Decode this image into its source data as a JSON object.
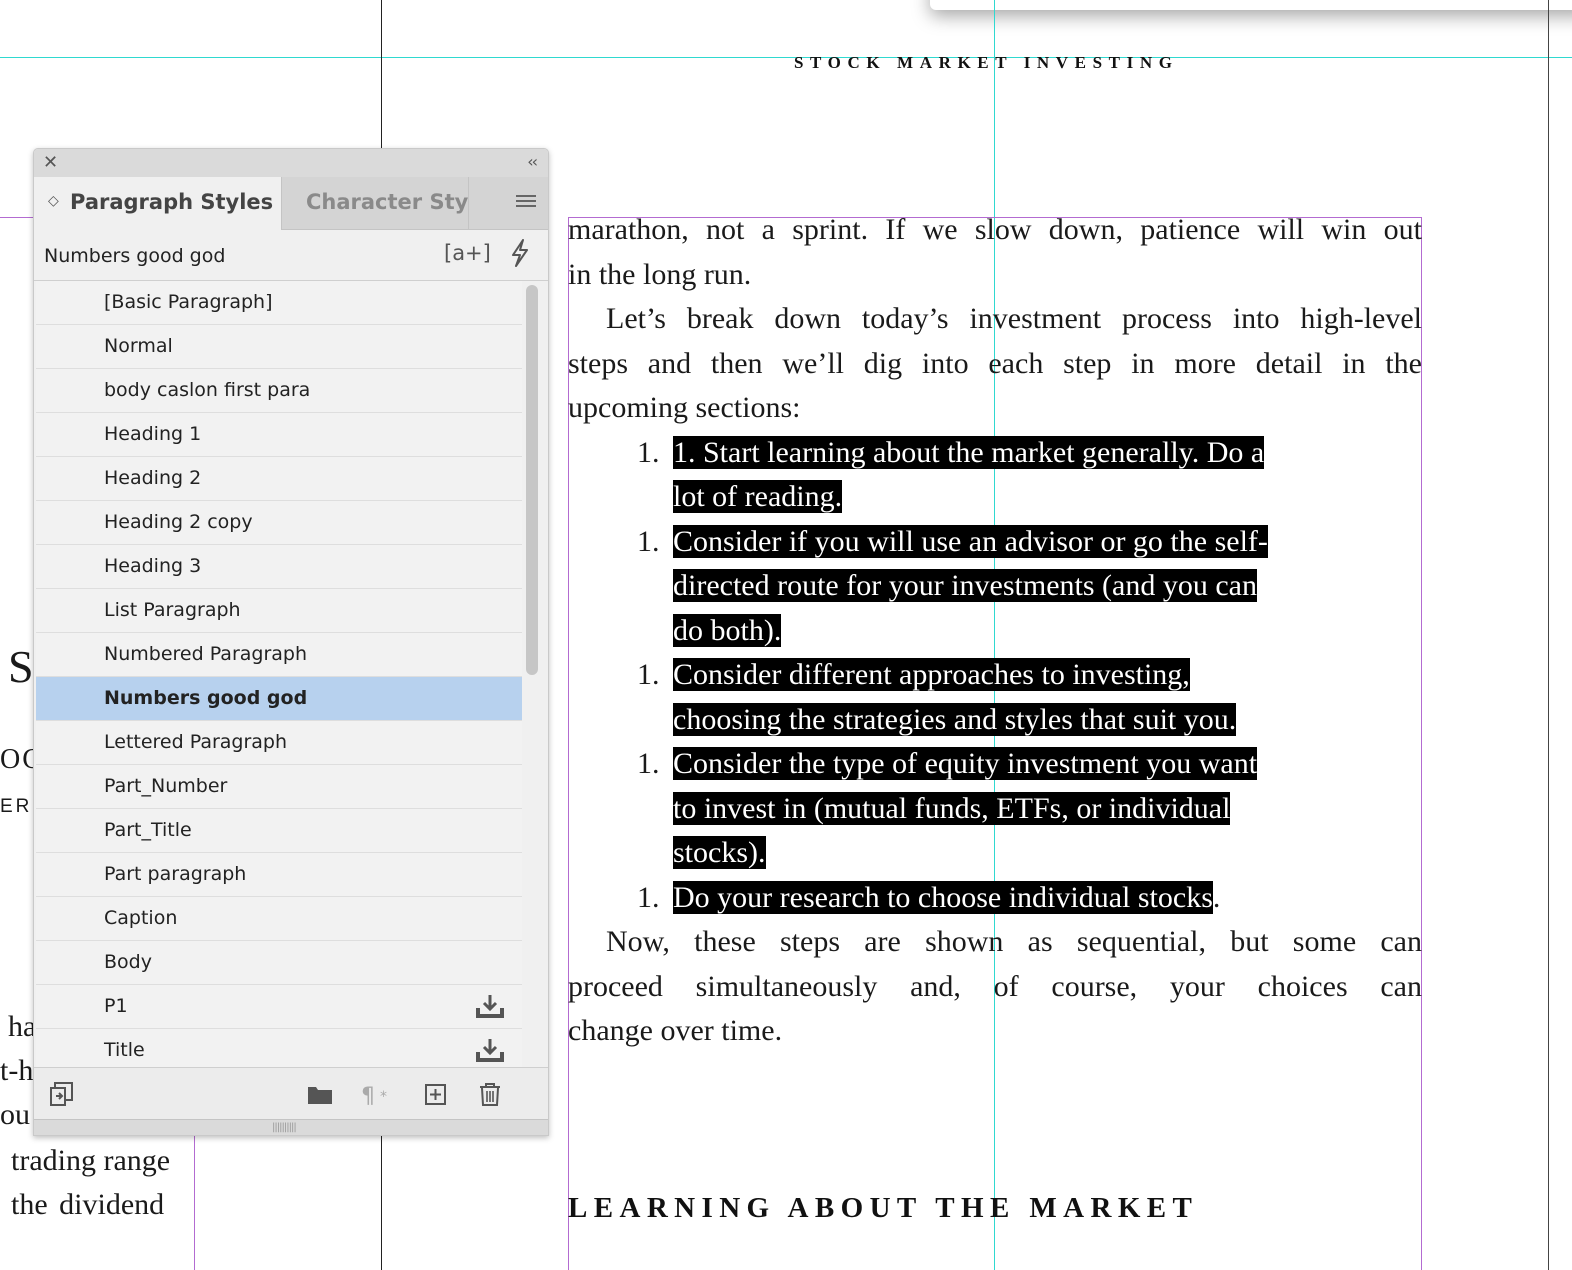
{
  "document": {
    "running_head": "STOCK MARKET INVESTING",
    "intro_lines": [
      "marathon, not a sprint. If we slow down, patience will win out",
      "in the long run."
    ],
    "para2_lines": [
      "Let’s break down today’s investment process into high-level",
      "steps and then we’ll dig into each step in more detail in the",
      "upcoming sections:"
    ],
    "list_number": "1.",
    "list_items": [
      {
        "lines": [
          "1.  Start learning about the market generally. Do a",
          "lot of reading. "
        ]
      },
      {
        "lines": [
          "Consider if you will use an advisor or go the self-",
          "directed route for your investments (and you can",
          "do both). "
        ]
      },
      {
        "lines": [
          "Consider different approaches to investing,",
          "choosing the strategies and styles that suit you. "
        ]
      },
      {
        "lines": [
          "Consider the type of equity investment you want",
          "to invest in (mutual funds, ETFs, or individual",
          "stocks). "
        ]
      },
      {
        "lines": [
          "Do your research to choose individual stocks"
        ]
      }
    ],
    "last_item_period": ".",
    "closing_lines": [
      "Now, these steps are shown as sequential, but some can",
      "proceed simultaneously and, of course, your choices can",
      "change over time."
    ],
    "section_heading": "LEARNING ABOUT THE MARKET",
    "left_page_fragments": [
      "S",
      "OC",
      "ER",
      "ha",
      "t-h",
      "ou",
      "trading range",
      "the  dividend"
    ]
  },
  "panel": {
    "tabs": [
      {
        "label": "Paragraph Styles",
        "active": true
      },
      {
        "label": "Character Styles",
        "active": false
      }
    ],
    "current_style": "Numbers good god",
    "override_icon_label": "[a+]",
    "styles": [
      {
        "name": "[Basic Paragraph]"
      },
      {
        "name": "Normal"
      },
      {
        "name": "body caslon first para"
      },
      {
        "name": "Heading 1"
      },
      {
        "name": "Heading 2"
      },
      {
        "name": "Heading 2 copy"
      },
      {
        "name": "Heading 3"
      },
      {
        "name": "List Paragraph"
      },
      {
        "name": "Numbered Paragraph"
      },
      {
        "name": "Numbers good god",
        "selected": true
      },
      {
        "name": "Lettered Paragraph"
      },
      {
        "name": "Part_Number"
      },
      {
        "name": "Part_Title"
      },
      {
        "name": "Part paragraph"
      },
      {
        "name": "Caption"
      },
      {
        "name": "Body"
      },
      {
        "name": "P1",
        "imported": true
      },
      {
        "name": "Title",
        "imported": true
      }
    ],
    "bottom_icons": [
      "load-styles-icon",
      "folder-icon",
      "clear-overrides-icon",
      "new-style-icon",
      "trash-icon"
    ]
  },
  "colors": {
    "guide": "#2fd9d0",
    "margin": "#b36bd1",
    "selection": "#b7d1ee",
    "highlight": "#000000"
  }
}
